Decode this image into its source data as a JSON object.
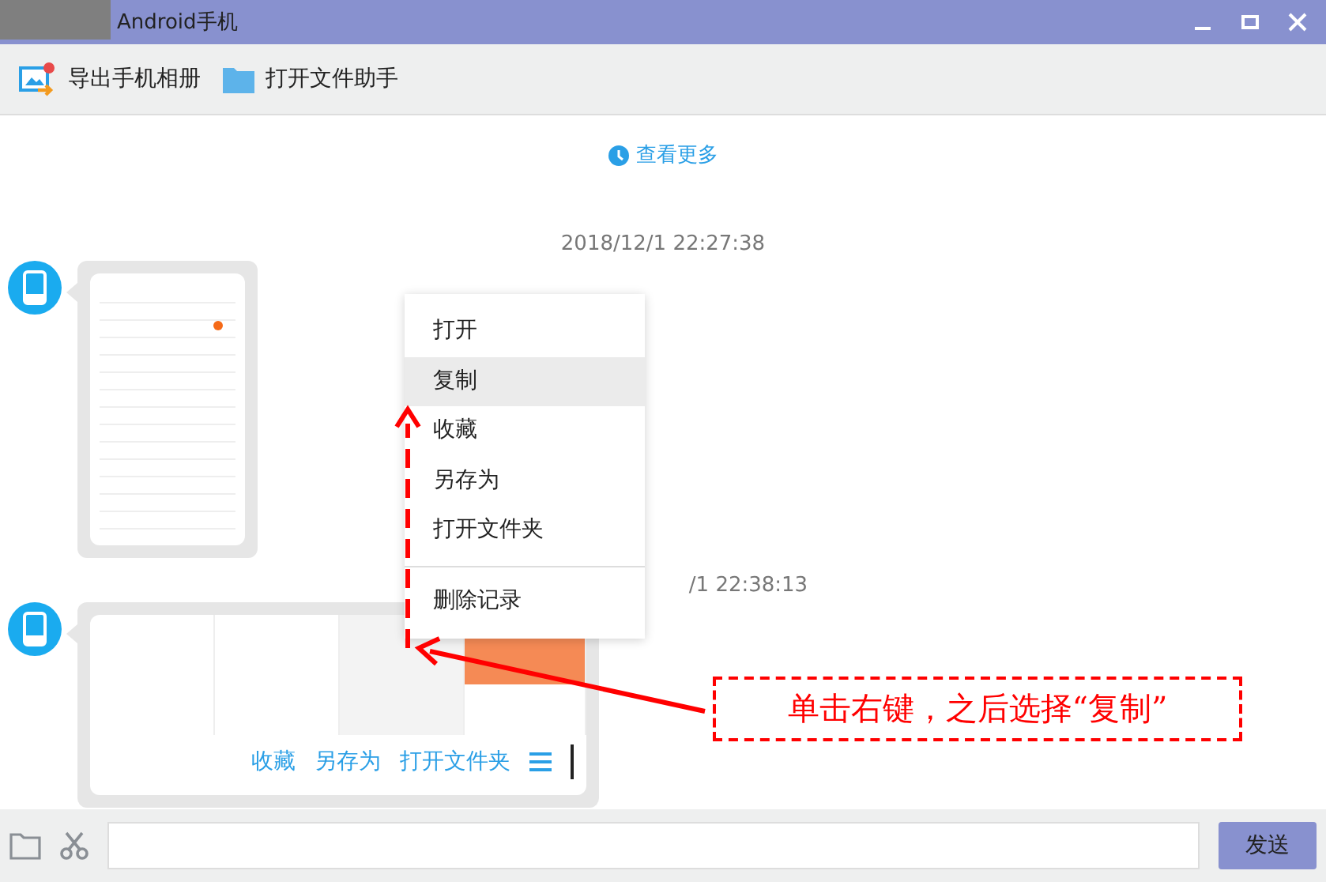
{
  "window": {
    "title": "Android手机"
  },
  "toolbar": [
    {
      "label": "导出手机相册",
      "kind": "export"
    },
    {
      "label": "打开文件助手",
      "kind": "folder"
    }
  ],
  "history_link": "查看更多",
  "messages": [
    {
      "timestamp": "2018/12/1 22:27:38",
      "covered": false,
      "kind": "portrait"
    },
    {
      "timestamp": "/1 22:38:13",
      "covered": true,
      "kind": "landscape",
      "actions": [
        "收藏",
        "另存为",
        "打开文件夹"
      ]
    }
  ],
  "context_menu": {
    "groups": [
      [
        {
          "label": "打开",
          "selected": false
        },
        {
          "label": "复制",
          "selected": true
        },
        {
          "label": "收藏",
          "selected": false
        },
        {
          "label": "另存为",
          "selected": false
        },
        {
          "label": "打开文件夹",
          "selected": false
        }
      ],
      [
        {
          "label": "删除记录",
          "selected": false
        }
      ]
    ]
  },
  "annotation": {
    "text": "单击右键，之后选择“复制”"
  },
  "composer": {
    "send_button": "发送"
  }
}
